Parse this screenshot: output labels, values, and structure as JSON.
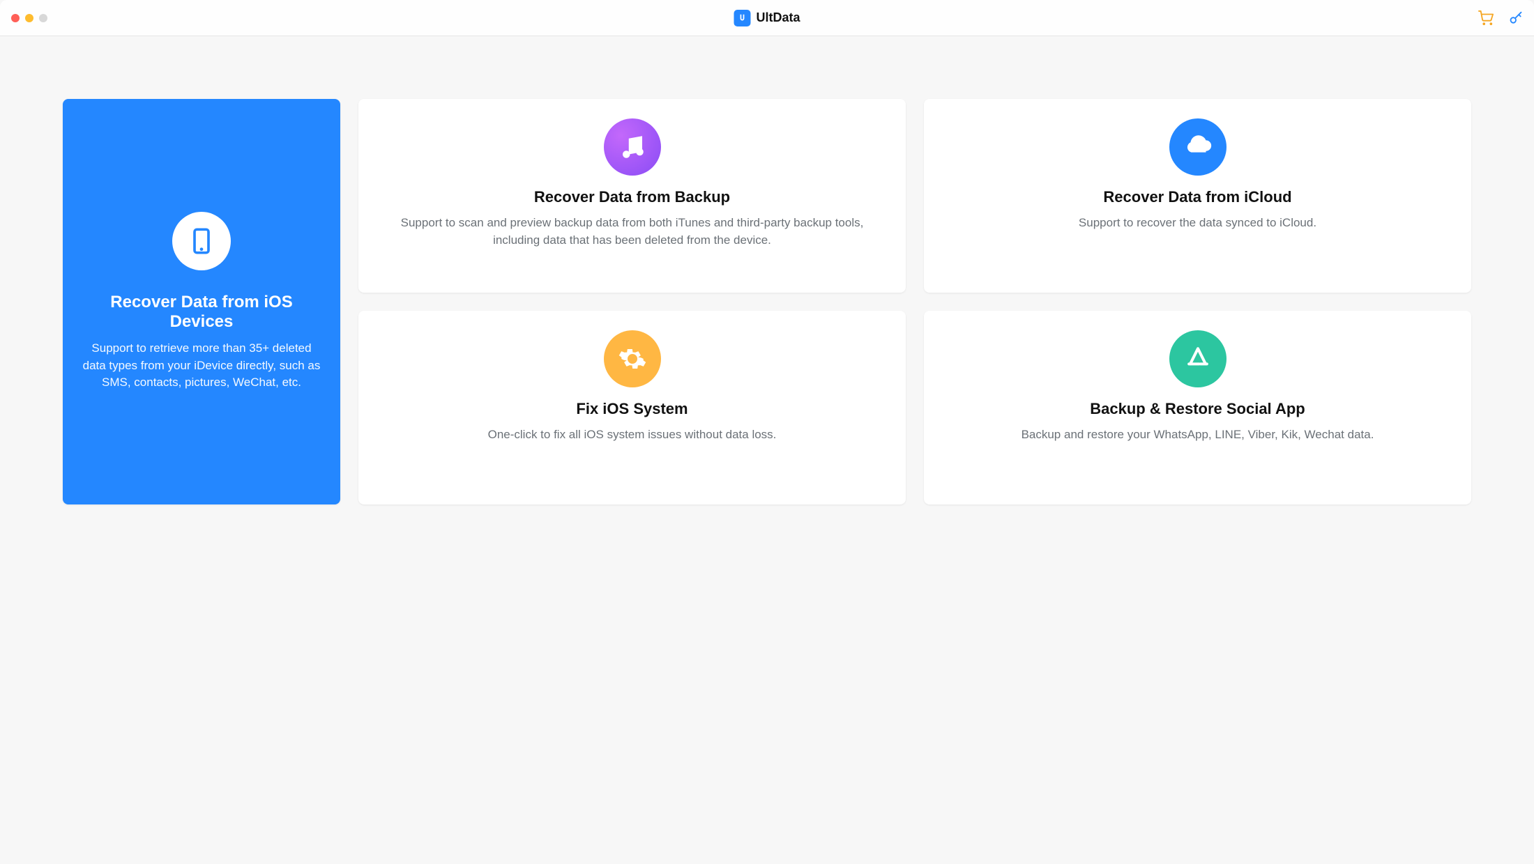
{
  "app": {
    "name": "UltData"
  },
  "cards": {
    "ios": {
      "title": "Recover Data from iOS Devices",
      "desc": "Support to retrieve more than 35+ deleted data types from your iDevice directly, such as SMS, contacts, pictures, WeChat, etc."
    },
    "backup": {
      "title": "Recover Data from Backup",
      "desc": "Support to scan and preview backup data from both iTunes and third-party backup tools, including data that has been deleted from the device."
    },
    "icloud": {
      "title": "Recover Data from iCloud",
      "desc": "Support to recover the data synced to iCloud."
    },
    "fix": {
      "title": "Fix iOS System",
      "desc": "One-click to fix all iOS system issues without data loss."
    },
    "social": {
      "title": "Backup & Restore Social App",
      "desc": "Backup and restore your WhatsApp, LINE, Viber, Kik, Wechat data."
    }
  }
}
